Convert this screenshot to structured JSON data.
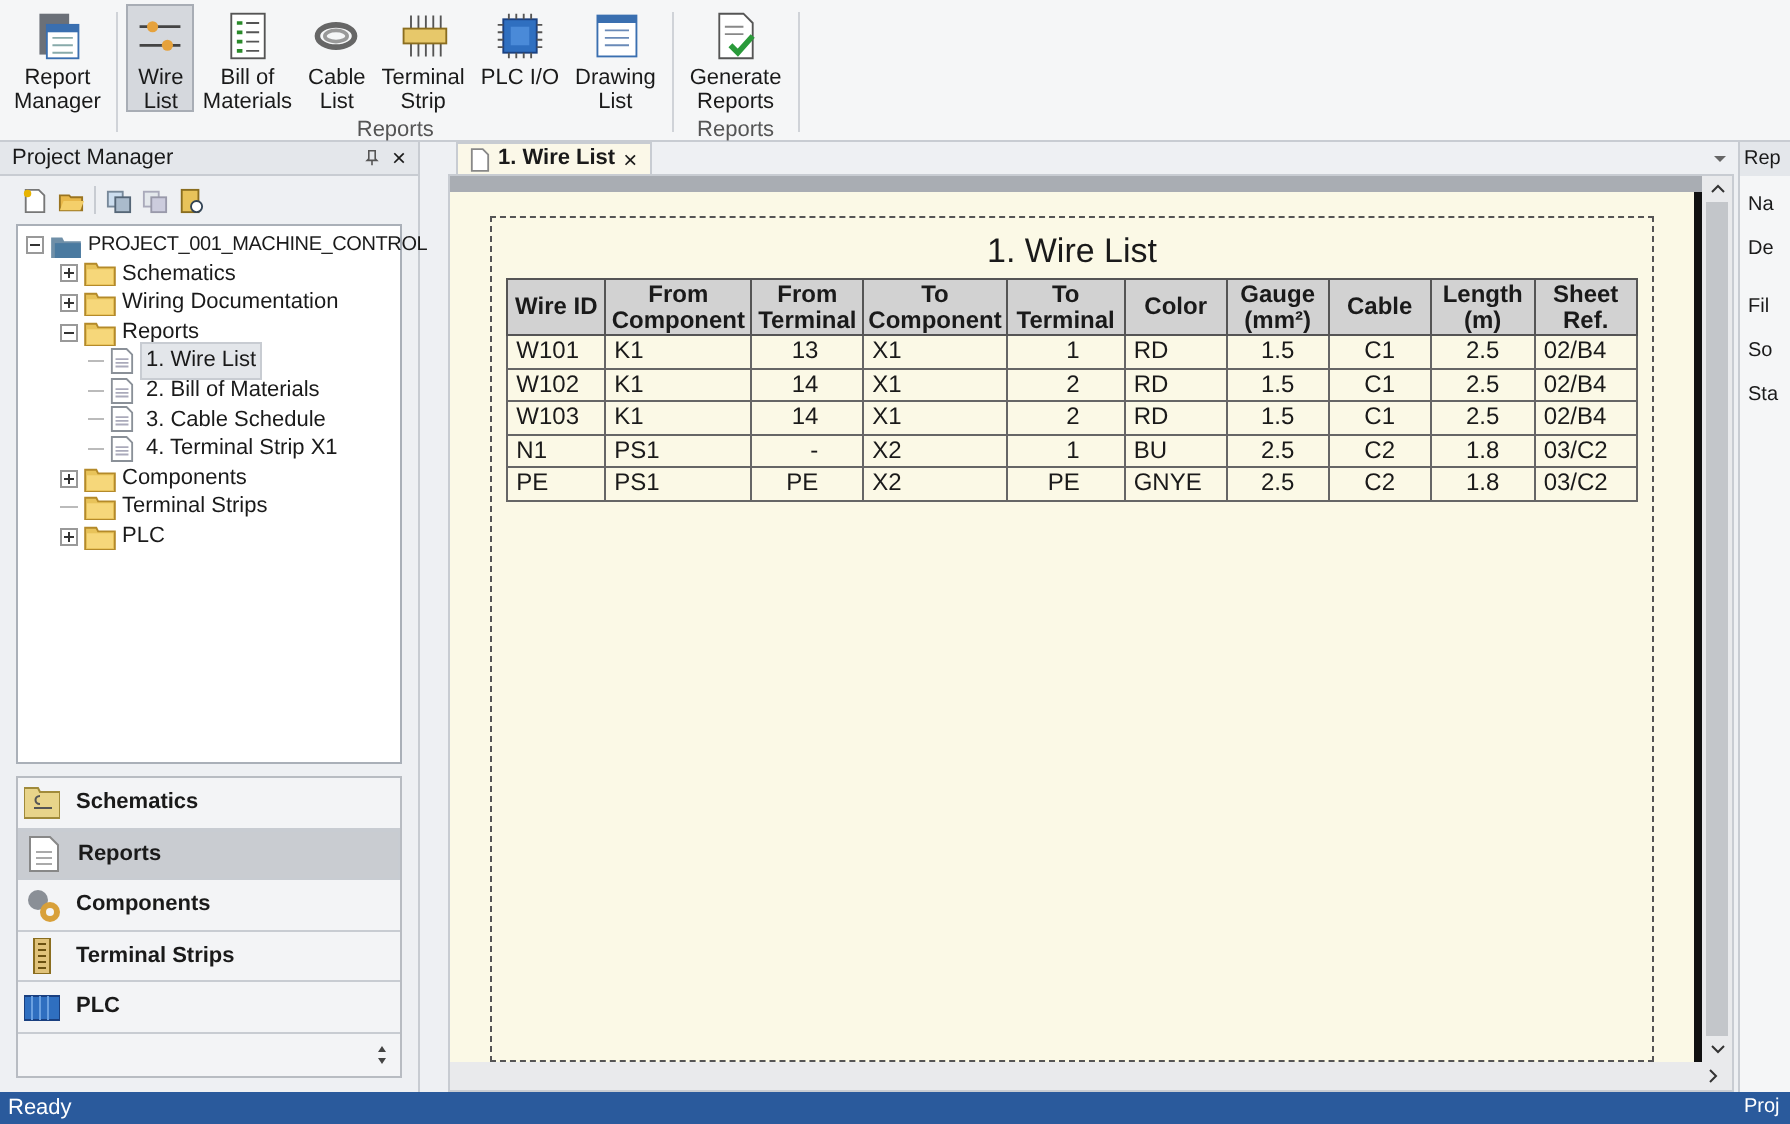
{
  "ribbon": {
    "groups": [
      {
        "buttons": [
          {
            "label": "Report\nManager",
            "selected": false
          }
        ]
      },
      {
        "label": "Reports",
        "buttons": [
          {
            "label": "Wire\nList",
            "selected": true
          },
          {
            "label": "Bill of\nMaterials",
            "selected": false
          },
          {
            "label": "Cable\nList",
            "selected": false
          },
          {
            "label": "Terminal\nStrip",
            "selected": false
          },
          {
            "label": "PLC I/O",
            "selected": false
          },
          {
            "label": "Drawing\nList",
            "selected": false
          }
        ]
      },
      {
        "label": "Reports",
        "buttons": [
          {
            "label": "Generate\nReports",
            "selected": false
          }
        ]
      }
    ]
  },
  "project_manager": {
    "title": "Project Manager",
    "close": "×",
    "tree": {
      "label": "PROJECT_001_MACHINE_CONTROL",
      "expanded": true,
      "children": [
        {
          "label": "Schematics",
          "kind": "folder",
          "expanded": false
        },
        {
          "label": "Wiring Documentation",
          "kind": "folder",
          "expanded": false
        },
        {
          "label": "Reports",
          "kind": "folder",
          "expanded": true,
          "children": [
            {
              "label": "1. Wire List",
              "selected": true
            },
            {
              "label": "2. Bill of Materials",
              "selected": false
            },
            {
              "label": "3. Cable Schedule",
              "selected": false
            },
            {
              "label": "4. Terminal Strip X1",
              "selected": false
            }
          ]
        },
        {
          "label": "Components",
          "kind": "folder",
          "expanded": false
        },
        {
          "label": "Terminal Strips",
          "kind": "empty_folder",
          "expanded": false
        },
        {
          "label": "PLC",
          "kind": "folder",
          "expanded": false
        }
      ]
    },
    "nav": [
      {
        "label": "Schematics",
        "selected": false
      },
      {
        "label": "Reports",
        "selected": true
      },
      {
        "label": "Components",
        "selected": false
      },
      {
        "label": "Terminal Strips",
        "selected": false
      },
      {
        "label": "PLC",
        "selected": false
      }
    ]
  },
  "document_tab": {
    "label": "1. Wire List",
    "close": "×",
    "selected": true
  },
  "report": {
    "title": "1. Wire List",
    "table": {
      "columns": [
        "Wire ID",
        "From\nComponent",
        "From\nTerminal",
        "To\nComponent",
        "To\nTerminal",
        "Color",
        "Gauge\n(mm²)",
        "Cable",
        "Length\n(m)",
        "Sheet\nRef."
      ],
      "rows": [
        [
          "W101",
          "K1",
          "13",
          "X1",
          "1",
          "RD",
          "1.5",
          "C1",
          "2.5",
          "02/B4"
        ],
        [
          "W102",
          "K1",
          "14",
          "X1",
          "2",
          "RD",
          "1.5",
          "C1",
          "2.5",
          "02/B4"
        ],
        [
          "W103",
          "K1",
          "14",
          "X1",
          "2",
          "RD",
          "1.5",
          "C1",
          "2.5",
          "02/B4"
        ],
        [
          "N1",
          "PS1",
          "-",
          "X2",
          "1",
          "BU",
          "2.5",
          "C2",
          "1.8",
          "03/C2"
        ],
        [
          "PE",
          "PS1",
          "PE",
          "X2",
          "PE",
          "GNYE",
          "2.5",
          "C2",
          "1.8",
          "03/C2"
        ]
      ]
    }
  },
  "properties": {
    "title": "Rep",
    "labels": [
      "Na",
      "De",
      "Fil",
      "So",
      "Sta"
    ]
  },
  "status_bar": {
    "left": "Ready",
    "right": "Proj"
  }
}
